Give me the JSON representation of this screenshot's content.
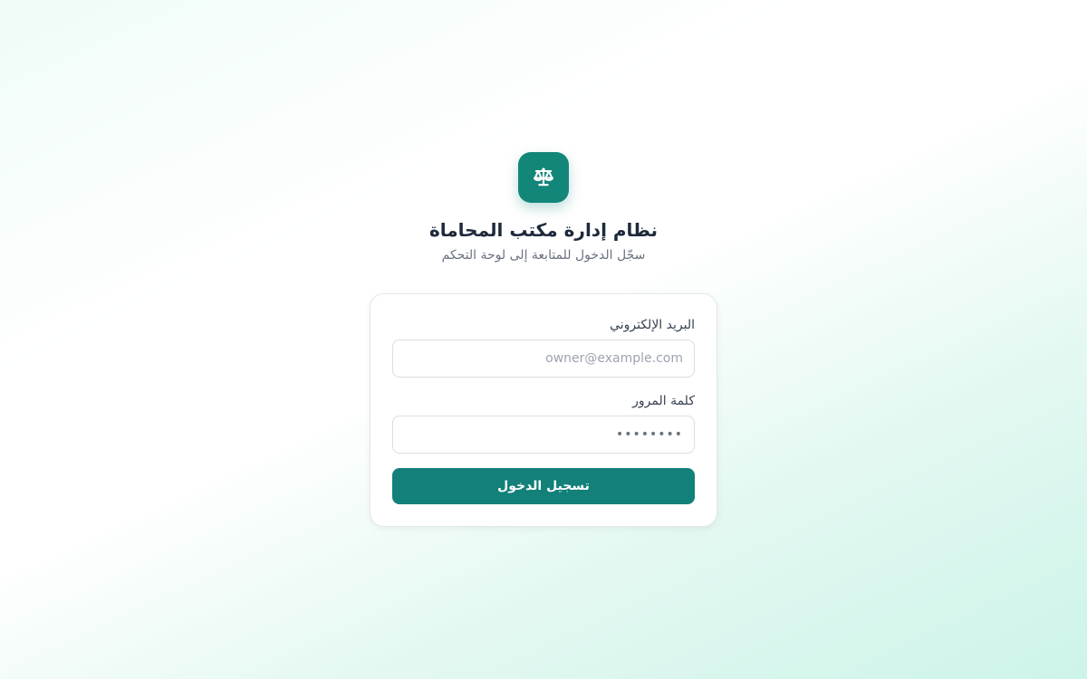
{
  "brand": {
    "icon": "scale-of-justice-icon",
    "accent_color": "#13867a"
  },
  "header": {
    "title": "نظام إدارة مكتب المحاماة",
    "subtitle": "سجّل الدخول للمتابعة إلى لوحة التحكم"
  },
  "login_form": {
    "email_label": "البريد الإلكتروني",
    "email_placeholder": "owner@example.com",
    "email_value": "",
    "password_label": "كلمة المرور",
    "password_placeholder": "••••••••",
    "password_value": "",
    "submit_label": "تسجيل الدخول",
    "button_color": "#13807a"
  }
}
